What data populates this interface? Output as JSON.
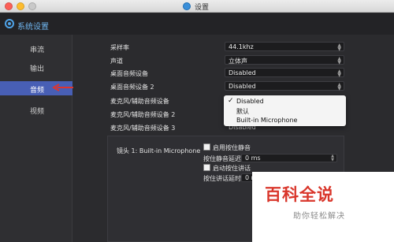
{
  "window": {
    "title": "设置"
  },
  "header": {
    "title": "系统设置"
  },
  "sidebar": {
    "items": [
      {
        "label": "串流"
      },
      {
        "label": "输出"
      },
      {
        "label": "音频"
      },
      {
        "label": "视频"
      }
    ],
    "active": "音频"
  },
  "audio": {
    "rows": [
      {
        "label": "采样率",
        "value": "44.1khz"
      },
      {
        "label": "声道",
        "value": "立体声"
      },
      {
        "label": "桌面音频设备",
        "value": "Disabled"
      },
      {
        "label": "桌面音频设备 2",
        "value": "Disabled"
      },
      {
        "label": "麦克风/辅助音频设备"
      },
      {
        "label": "麦克风/辅助音频设备 2"
      },
      {
        "label": "麦克风/辅助音频设备 3"
      }
    ],
    "dropdown": {
      "options": [
        "Disabled",
        "默认",
        "Built-in Microphone"
      ],
      "selected": "Disabled"
    },
    "obscured_value": "Disabled",
    "mic_panel": {
      "label": "镜头 1: Built-in Microphone",
      "mute_checkbox": "启用按住静音",
      "mute_delay_label": "按住静音延迟",
      "mute_delay_value": "0 ms",
      "talk_checkbox": "启动按住讲话",
      "talk_delay_label": "按住讲话延时",
      "talk_delay_value": "0 ms"
    }
  },
  "watermark": {
    "title": "百科全说",
    "subtitle": "助你轻松解决"
  },
  "colors": {
    "accent": "#485fb5",
    "header_link": "#6fb5ef",
    "arrow": "#e0342c",
    "watermark": "#d9362b"
  }
}
